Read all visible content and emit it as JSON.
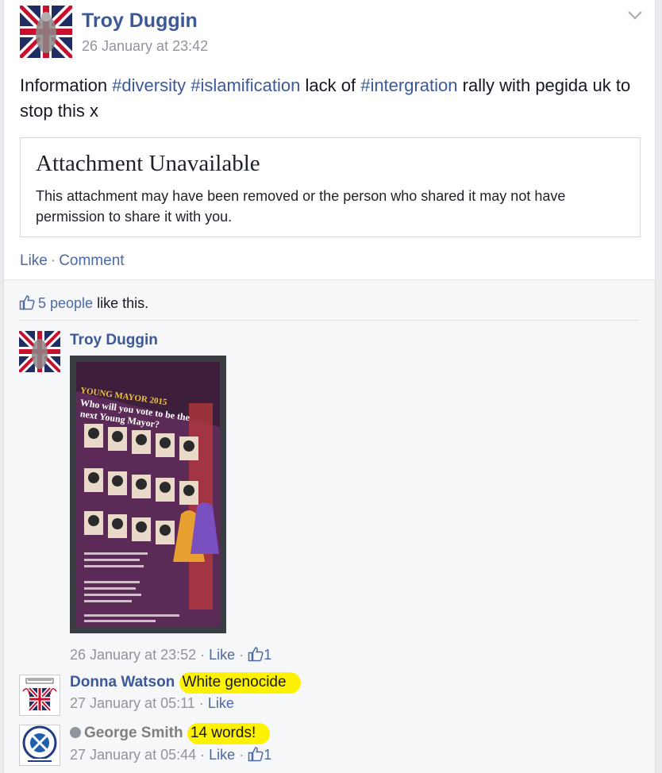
{
  "post": {
    "author": "Troy Duggin",
    "timestamp": "26 January at 23:42",
    "body": {
      "t1": "Information ",
      "h1": "#diversity",
      "t2": " ",
      "h2": "#islamification",
      "t3": " lack of ",
      "h3": "#intergration",
      "t4": " rally with pegida uk to stop this x"
    },
    "attachment": {
      "title": "Attachment Unavailable",
      "text": "This attachment may have been removed or the person who shared it may not have permission to share it with you."
    },
    "actions": {
      "like": "Like",
      "separator": "·",
      "comment": "Comment"
    },
    "likes": {
      "count_link": "5 people",
      "suffix": " like this."
    }
  },
  "photo": {
    "poster_line1": "YOUNG MAYOR 2015",
    "poster_line2": "Who will you vote to be the",
    "poster_line3": "next Young Mayor?"
  },
  "comments": [
    {
      "author": "Troy Duggin",
      "text": "",
      "timestamp": "26 January at 23:52",
      "like": "Like",
      "likes": "1"
    },
    {
      "author": "Donna Watson",
      "text": "White genocide",
      "timestamp": "27 January at 05:11",
      "like": "Like"
    },
    {
      "author": "George Smith",
      "text": "14 words!",
      "timestamp": "27 January at 05:44",
      "like": "Like",
      "likes": "1"
    }
  ],
  "colors": {
    "link_blue": "#3b5998",
    "highlight": "#fff200",
    "meta_gray": "#90949c"
  },
  "icons": [
    "chevron-down-icon",
    "thumbs-up-icon"
  ]
}
